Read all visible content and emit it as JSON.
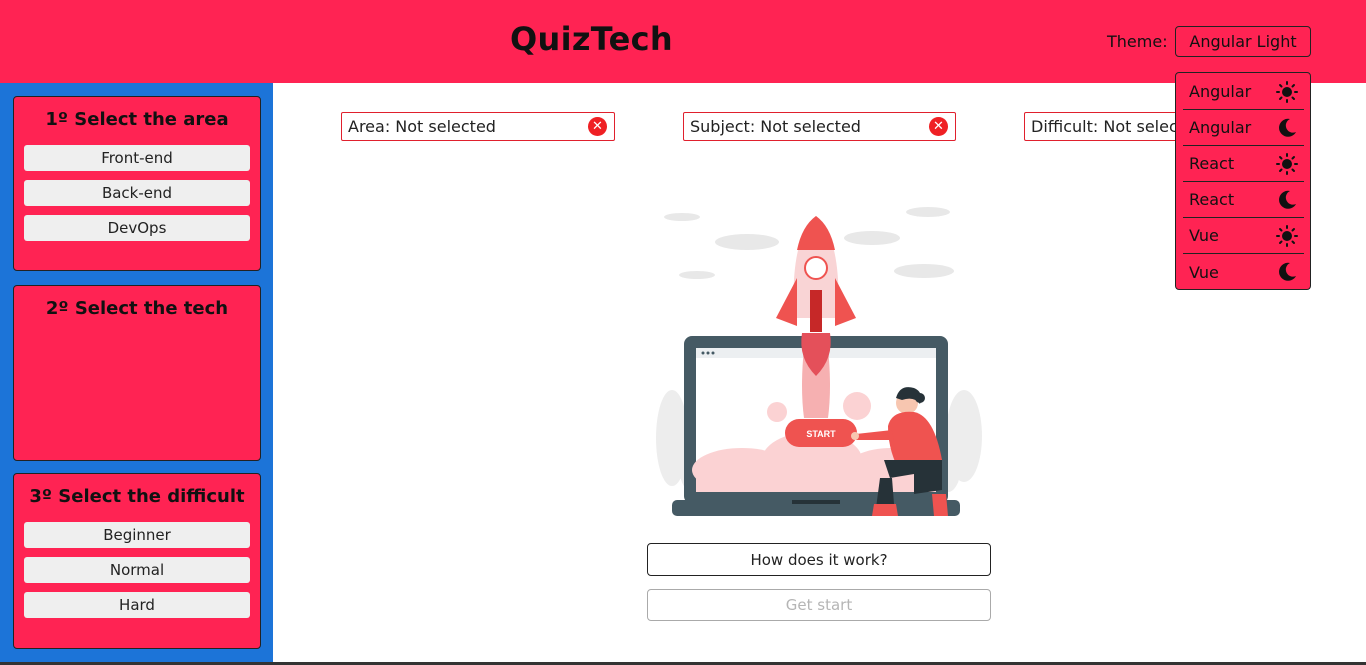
{
  "header": {
    "title": "QuizTech",
    "theme_label": "Theme:",
    "theme_value": "Angular Light"
  },
  "sidebar": {
    "area": {
      "title": "1º Select the area",
      "options": [
        "Front-end",
        "Back-end",
        "DevOps"
      ]
    },
    "tech": {
      "title": "2º Select the tech"
    },
    "difficulty": {
      "title": "3º Select the difficult",
      "options": [
        "Beginner",
        "Normal",
        "Hard"
      ]
    }
  },
  "filters": {
    "area": "Area: Not selected",
    "subject": "Subject: Not selected",
    "difficult": "Difficult: Not selected",
    "clear_symbol": "✕"
  },
  "illustration": {
    "start_label": "START"
  },
  "actions": {
    "how_label": "How does it work?",
    "start_label": "Get start"
  },
  "theme_menu": {
    "options": [
      {
        "label": "Angular",
        "icon": "sun-icon"
      },
      {
        "label": "Angular",
        "icon": "moon-icon"
      },
      {
        "label": "React",
        "icon": "sun-icon"
      },
      {
        "label": "React",
        "icon": "moon-icon"
      },
      {
        "label": "Vue",
        "icon": "sun-icon"
      },
      {
        "label": "Vue",
        "icon": "moon-icon"
      }
    ]
  },
  "colors": {
    "primary": "#ff2353",
    "sidebar": "#1c74d8",
    "accent_red": "#ef2024"
  }
}
